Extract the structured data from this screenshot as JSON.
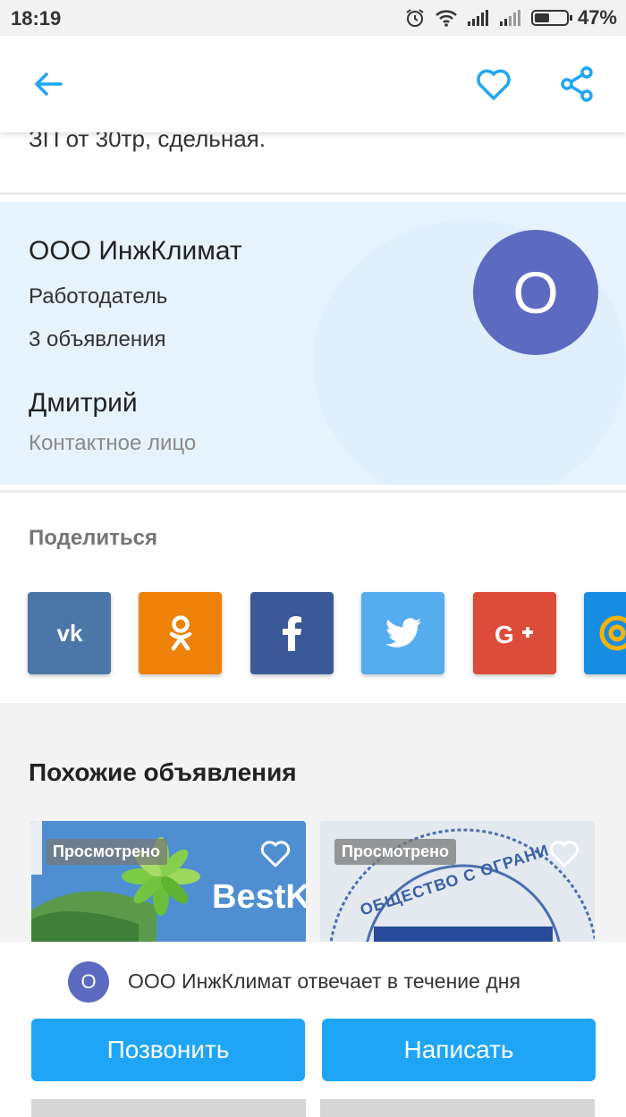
{
  "status_bar": {
    "time": "18:19",
    "battery": "47%",
    "battery_level": 0.47
  },
  "clipped_description": "ЗП от 30тр, сдельная.",
  "seller": {
    "company": "ООО ИнжКлимат",
    "role": "Работодатель",
    "ads_count": "3 объявления",
    "avatar_letter": "О",
    "contact_name": "Дмитрий",
    "contact_role": "Контактное лицо"
  },
  "share": {
    "title": "Поделиться",
    "buttons": [
      {
        "name": "vk",
        "label": "VK",
        "color": "#4a76a8"
      },
      {
        "name": "odnoklassniki",
        "label": "OK",
        "color": "#ee8208"
      },
      {
        "name": "facebook",
        "label": "f",
        "color": "#3b5998"
      },
      {
        "name": "twitter",
        "label": "twitter",
        "color": "#55acee"
      },
      {
        "name": "google-plus",
        "label": "G+",
        "color": "#dd4b39"
      },
      {
        "name": "more",
        "label": "",
        "color": "#168de2"
      }
    ]
  },
  "similar": {
    "title": "Похожие объявления",
    "cards": [
      {
        "badge": "Просмотрено",
        "logo_text": "BestK"
      },
      {
        "badge": "Просмотрено",
        "seal_text": "ОБЩЕСТВО С ОГРАНИ"
      }
    ]
  },
  "bottom": {
    "avatar_letter": "О",
    "response_text": "ООО ИнжКлимат отвечает в течение дня",
    "call_label": "Позвонить",
    "message_label": "Написать"
  },
  "colors": {
    "accent": "#1ea5f6",
    "avatar": "#5c6bc0",
    "seller_bg": "#e6f3fd"
  }
}
